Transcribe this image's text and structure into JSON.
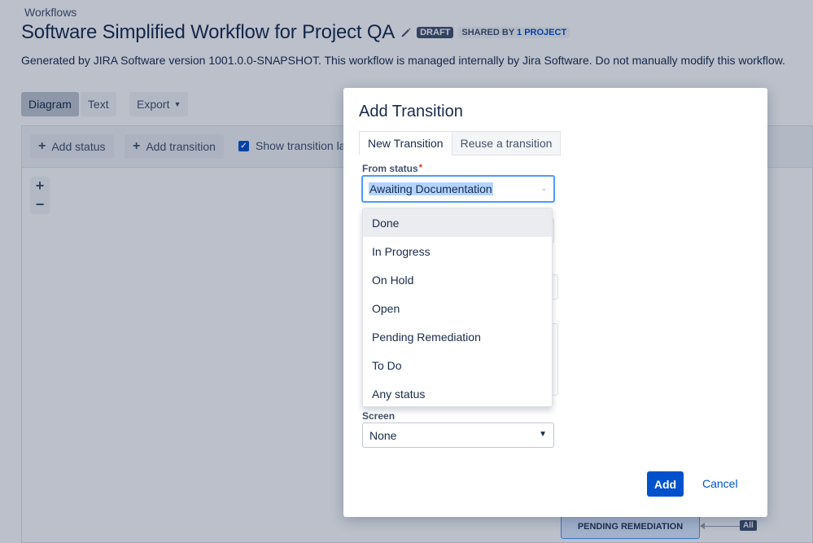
{
  "header": {
    "breadcrumb": "Workflows",
    "title": "Software Simplified Workflow for Project QA",
    "draft_badge": "DRAFT",
    "shared_by_label": "SHARED BY",
    "shared_projects_link": "1 PROJECT",
    "description": "Generated by JIRA Software version 1001.0.0-SNAPSHOT. This workflow is managed internally by Jira Software. Do not manually modify this workflow."
  },
  "view_tabs": [
    {
      "label": "Diagram",
      "active": true
    },
    {
      "label": "Text",
      "active": false
    }
  ],
  "export_label": "Export",
  "toolbar": {
    "add_status": "Add status",
    "add_transition": "Add transition",
    "show_transition_labels": "Show transition la",
    "show_transition_labels_checked": true
  },
  "zoom": {
    "in": "+",
    "out": "−"
  },
  "diagram": {
    "status_node": "PENDING REMEDIATION",
    "all_badge": "All"
  },
  "dialog": {
    "title": "Add Transition",
    "tabs": [
      {
        "label": "New Transition",
        "active": true
      },
      {
        "label": "Reuse a transition",
        "active": false
      }
    ],
    "from_status_label": "From status",
    "required_marker": "*",
    "from_status_value": "Awaiting Documentation",
    "from_status_options": [
      "Done",
      "In Progress",
      "On Hold",
      "Open",
      "Pending Remediation",
      "To Do",
      "Any status"
    ],
    "highlighted_option_index": 0,
    "screen_label": "Screen",
    "screen_value": "None",
    "add_button": "Add",
    "cancel_link": "Cancel"
  },
  "colors": {
    "primary": "#0052cc",
    "focus_ring": "#4c9aff",
    "overlay": "rgba(9,30,66,0.28)",
    "draft_badge": "#42526e",
    "required": "#de350b"
  },
  "icons": [
    "pencil-icon",
    "chevron-down-icon",
    "plus-icon",
    "checkbox-checked-icon"
  ]
}
